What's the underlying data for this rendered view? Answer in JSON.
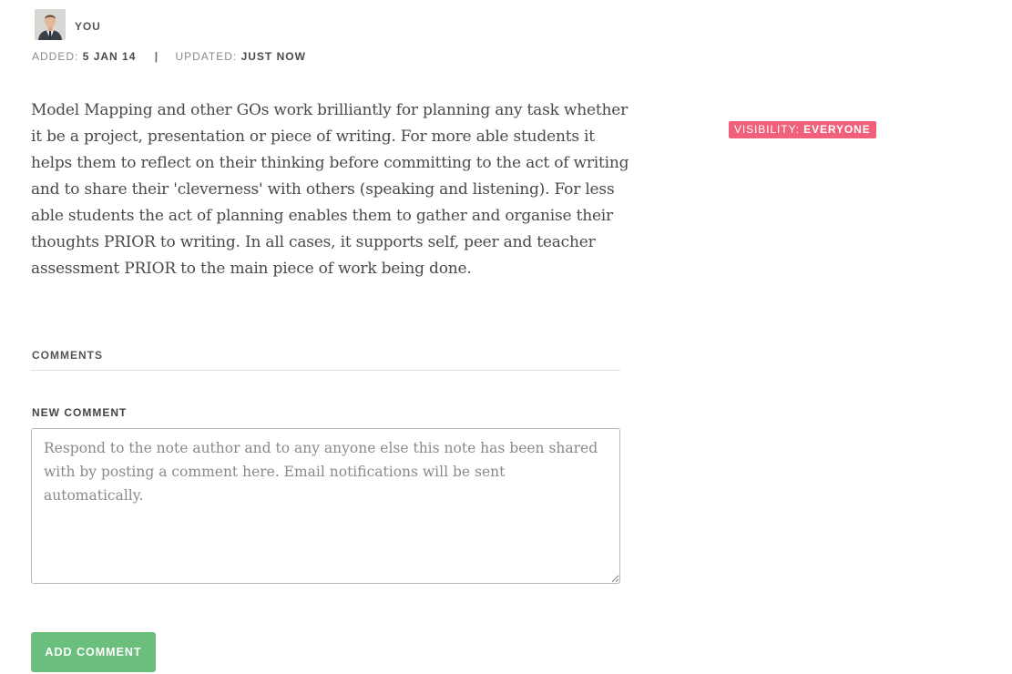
{
  "note": {
    "author": "You",
    "added_label": "Added:",
    "added_value": "5 Jan 14",
    "separator": "|",
    "updated_label": "Updated:",
    "updated_value": "Just now",
    "body": "Model Mapping and other GOs work brilliantly for planning any task whether it be a project, presentation or piece of writing. For more able students it helps them to reflect on their thinking before committing to the act of writing and to share their 'cleverness' with others (speaking and listening). For less able students the act of planning enables them to gather and organise their thoughts PRIOR to writing. In all cases, it supports self, peer and teacher assessment PRIOR to the main piece of work being done."
  },
  "visibility": {
    "label": "Visibility:",
    "value": "Everyone",
    "color": "#f0607a"
  },
  "comments": {
    "heading": "Comments",
    "new_label": "New Comment",
    "placeholder": "Respond to the note author and to any anyone else this note has been shared with by posting a comment here. Email notifications will be sent automatically.",
    "submit_label": "Add Comment",
    "submit_color": "#6bbf7c"
  }
}
